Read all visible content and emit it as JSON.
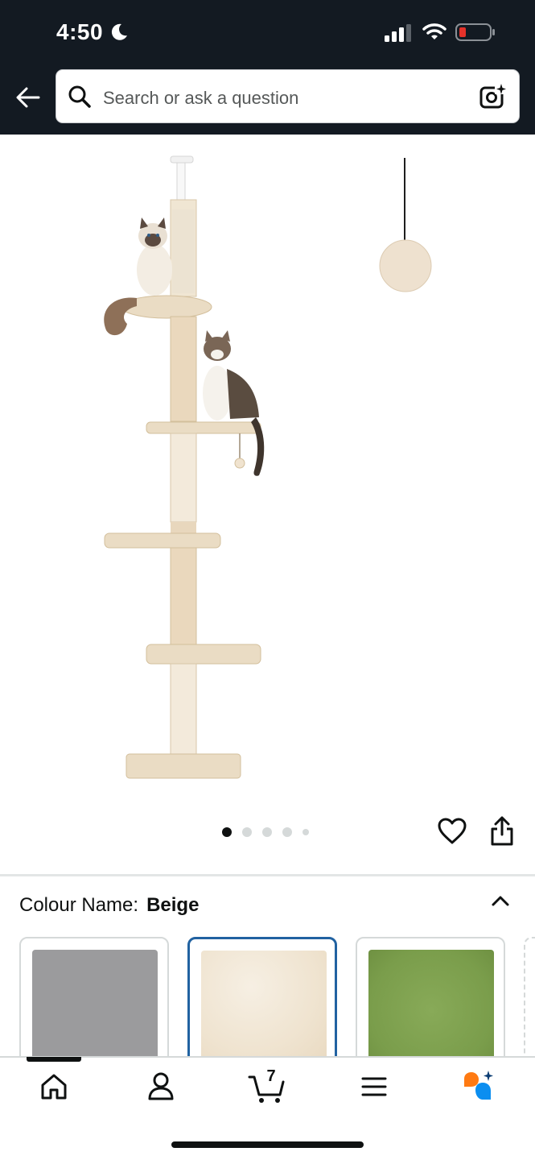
{
  "status_bar": {
    "time": "4:50",
    "icons": [
      "moon-icon",
      "cellular-signal-icon",
      "wifi-icon",
      "battery-low-icon"
    ]
  },
  "header": {
    "search_placeholder": "Search or ask a question",
    "icons": [
      "back-arrow-icon",
      "search-icon",
      "camera-search-icon"
    ]
  },
  "product": {
    "image_name": "beige floor-to-ceiling cat tree with two cats",
    "image_count": 5,
    "current_image": 1
  },
  "colour": {
    "label": "Colour Name:",
    "selected": "Beige",
    "swatches": [
      {
        "name": "grey",
        "color": "#9b9b9d"
      },
      {
        "name": "beige",
        "color": "#f1e6d6"
      },
      {
        "name": "green",
        "color": "#7ea150"
      }
    ]
  },
  "bottom_nav": {
    "cart_count": "7",
    "items": [
      "home-icon",
      "account-icon",
      "cart-icon",
      "menu-icon",
      "rufus-icon"
    ]
  },
  "colors": {
    "header_bg": "#131a22",
    "selected_border": "#2162a1",
    "battery_low": "#e5322a"
  }
}
